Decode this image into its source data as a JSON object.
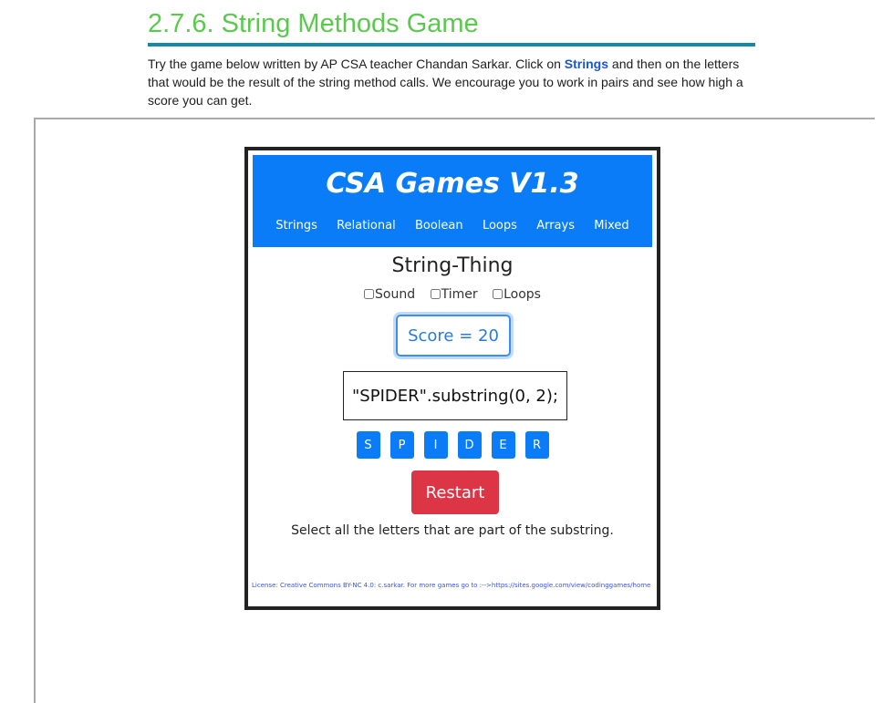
{
  "page": {
    "title": "2.7.6. String Methods Game",
    "intro_before": "Try the game below written by AP CSA teacher Chandan Sarkar. Click on ",
    "intro_link": "Strings",
    "intro_after": " and then on the letters that would be the result of the string method calls. We encourage you to work in pairs and see how high a score you can get."
  },
  "game": {
    "title": "CSA Games V1.3",
    "nav": [
      "Strings",
      "Relational",
      "Boolean",
      "Loops",
      "Arrays",
      "Mixed"
    ],
    "subtitle": "String-Thing",
    "options": [
      "Sound",
      "Timer",
      "Loops"
    ],
    "score": "Score = 20",
    "expression": "\"SPIDER\".substring(0, 2);",
    "letters": [
      "S",
      "P",
      "I",
      "D",
      "E",
      "R"
    ],
    "restart_label": "Restart",
    "instruction": "Select all the letters that are part of the substring.",
    "license": "License: Creative Commons BY-NC 4.0: c.sarkar. For more games go to :-->https://sites.google.com/view/codinggames/home"
  },
  "colors": {
    "title_green": "#5bc94e",
    "header_blue": "#0a7cf8",
    "restart_red": "#dc3545"
  }
}
